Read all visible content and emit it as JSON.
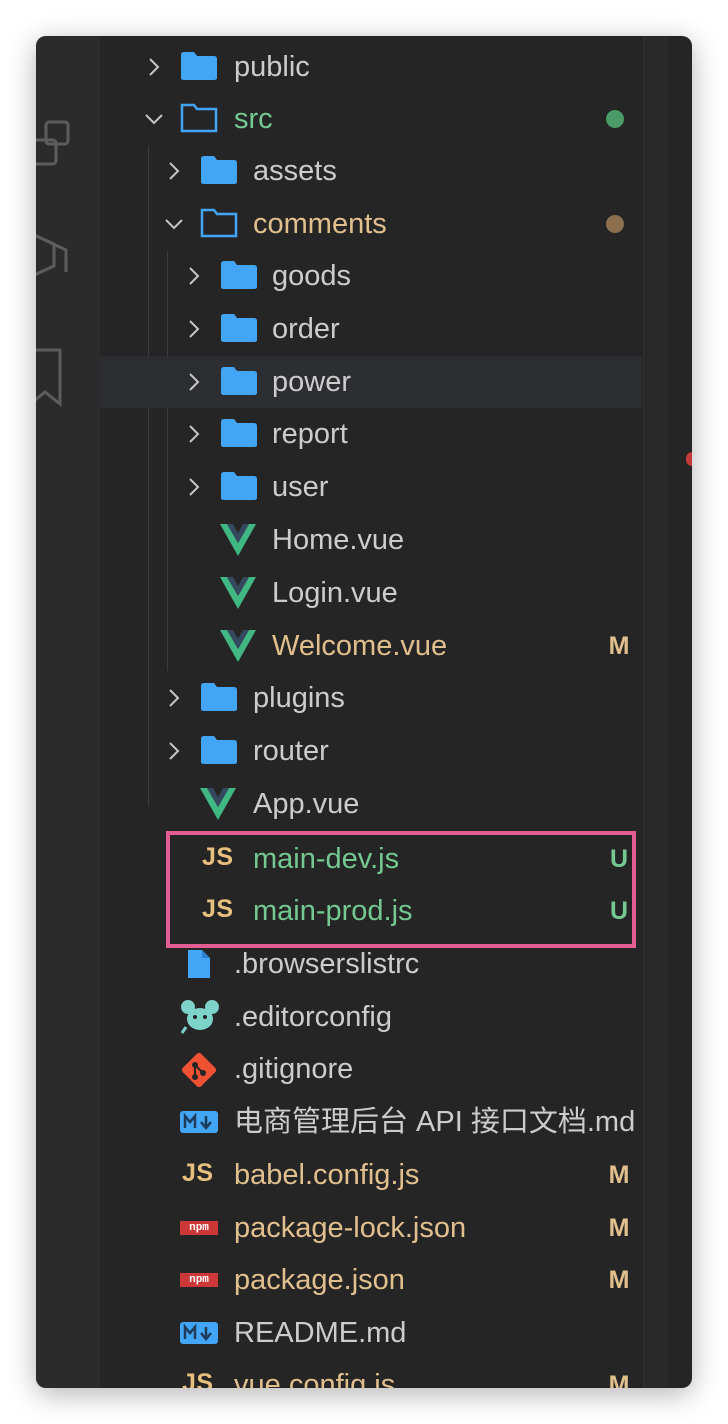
{
  "tree": {
    "public": "public",
    "src": "src",
    "assets": "assets",
    "comments": "comments",
    "goods": "goods",
    "order": "order",
    "power": "power",
    "report": "report",
    "user": "user",
    "home_vue": "Home.vue",
    "login_vue": "Login.vue",
    "welcome_vue": "Welcome.vue",
    "plugins": "plugins",
    "router": "router",
    "app_vue": "App.vue",
    "main_dev": "main-dev.js",
    "main_prod": "main-prod.js",
    "browserslistrc": ".browserslistrc",
    "editorconfig": ".editorconfig",
    "gitignore": ".gitignore",
    "api_doc": "电商管理后台 API 接口文档.md",
    "babel_config": "babel.config.js",
    "package_lock": "package-lock.json",
    "package_json": "package.json",
    "readme": "README.md",
    "vue_config": "vue.config.js"
  },
  "badges": {
    "modified": "M",
    "untracked": "U"
  },
  "icon_text": {
    "js": "JS",
    "npm": "npm"
  },
  "colors": {
    "background": "#252526",
    "folder": "#42a5f5",
    "vue_dark": "#35495e",
    "vue_green": "#41b883",
    "untracked": "#73c991",
    "modified": "#e2c08d",
    "highlight_border": "#e25d91"
  },
  "icons": {
    "activity_1": "extensions-icon",
    "activity_2": "remote-explorer-icon",
    "activity_3": "bookmark-icon"
  }
}
